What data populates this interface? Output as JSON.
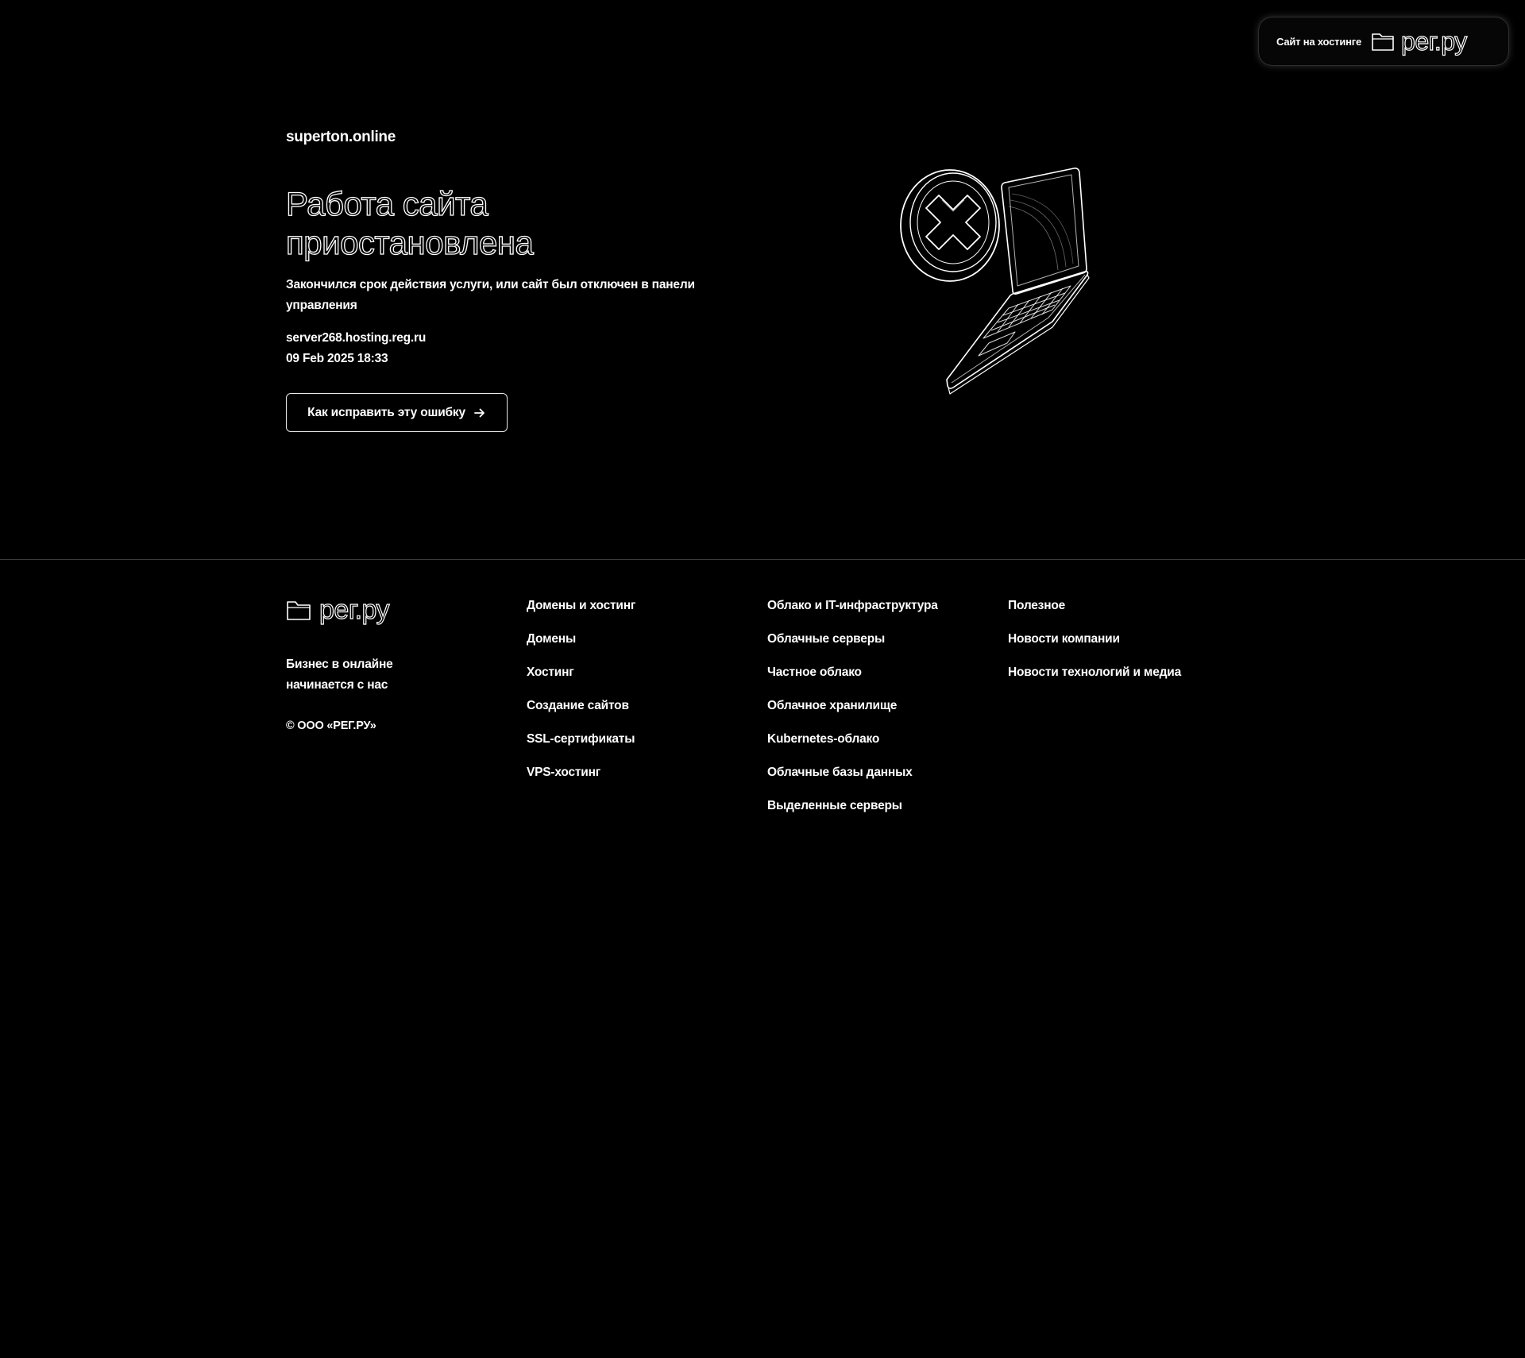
{
  "badge": {
    "text": "Сайт на хостинге",
    "logo_text": "рег.ру",
    "icon": "folder-icon"
  },
  "main": {
    "domain": "superton.online",
    "title": "Работа сайта приостановлена",
    "description": "Закончился срок действия услуги, или сайт был отключен в панели управления",
    "server": "server268.hosting.reg.ru",
    "datetime": "09 Feb 2025 18:33",
    "fix_button_label": "Как исправить эту ошибку",
    "fix_button_icon": "arrow-right-icon",
    "illustration_icon": "laptop-error-icon"
  },
  "footer": {
    "logo_text": "рег.ру",
    "logo_icon": "folder-icon",
    "tagline": "Бизнес в онлайне начинается с нас",
    "copyright": "© ООО «РЕГ.РУ»",
    "columns": [
      {
        "heading": "Домены и хостинг",
        "links": [
          "Домены",
          "Хостинг",
          "Создание сайтов",
          "SSL-сертификаты",
          "VPS-хостинг"
        ]
      },
      {
        "heading": "Облако и IT-инфраструктура",
        "links": [
          "Облачные серверы",
          "Частное облако",
          "Облачное хранилище",
          "Kubernetes-облако",
          "Облачные базы данных",
          "Выделенные серверы"
        ]
      },
      {
        "heading": "Полезное",
        "links": [
          "Новости компании",
          "Новости технологий и медиа"
        ]
      }
    ]
  },
  "colors": {
    "background": "#000000",
    "text": "#ffffff",
    "outline": "#e9e9e9",
    "divider": "#3a3a3a"
  }
}
